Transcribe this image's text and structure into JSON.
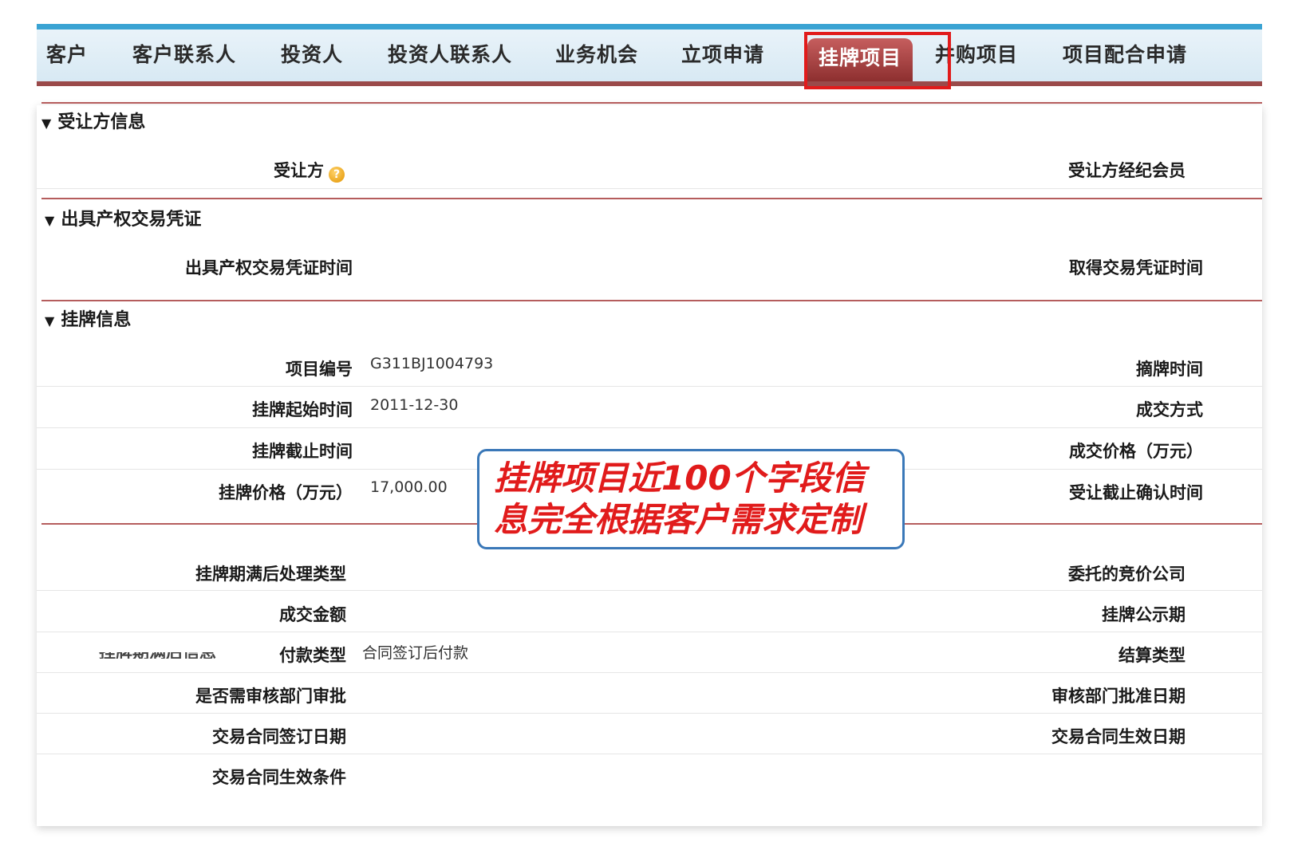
{
  "tabs": [
    {
      "label": "客户"
    },
    {
      "label": "客户联系人"
    },
    {
      "label": "投资人"
    },
    {
      "label": "投资人联系人"
    },
    {
      "label": "业务机会"
    },
    {
      "label": "立项申请"
    },
    {
      "label": "挂牌项目"
    },
    {
      "label": "并购项目"
    },
    {
      "label": "项目配合申请"
    }
  ],
  "active_tab": "挂牌项目",
  "sections": {
    "transferee": {
      "title": "受让方信息",
      "left_label": "受让方",
      "right_label": "受让方经纪会员"
    },
    "certificate": {
      "title": "出具产权交易凭证",
      "left_label": "出具产权交易凭证时间",
      "right_label": "取得交易凭证时间"
    },
    "listing": {
      "title": "挂牌信息",
      "rows": [
        {
          "left": "项目编号",
          "value": "G311BJ1004793",
          "right": "摘牌时间"
        },
        {
          "left": "挂牌起始时间",
          "value": "2011-12-30",
          "right": "成交方式"
        },
        {
          "left": "挂牌截止时间",
          "value": "",
          "right": "成交价格（万元）"
        },
        {
          "left": "挂牌价格（万元）",
          "value": "17,000.00",
          "right": "受让截止确认时间"
        }
      ]
    },
    "post_listing": {
      "title": "挂牌期满后信息",
      "rows": [
        {
          "left": "挂牌期满后处理类型",
          "value": "",
          "right": "委托的竞价公司"
        },
        {
          "left": "成交金额",
          "value": "",
          "right": "挂牌公示期"
        },
        {
          "left": "付款类型",
          "value": "合同签订后付款",
          "right": "结算类型"
        },
        {
          "left": "是否需审核部门审批",
          "value": "",
          "right": "审核部门批准日期"
        },
        {
          "left": "交易合同签订日期",
          "value": "",
          "right": "交易合同生效日期"
        },
        {
          "left": "交易合同生效条件",
          "value": "",
          "right": ""
        }
      ]
    }
  },
  "callout": {
    "line1": "挂牌项目近100个字段信",
    "line2": "息完全根据客户需求定制"
  },
  "colors": {
    "accent_blue": "#3aa3d3",
    "tab_active": "#a64040",
    "highlight_red": "#e11b1b"
  }
}
